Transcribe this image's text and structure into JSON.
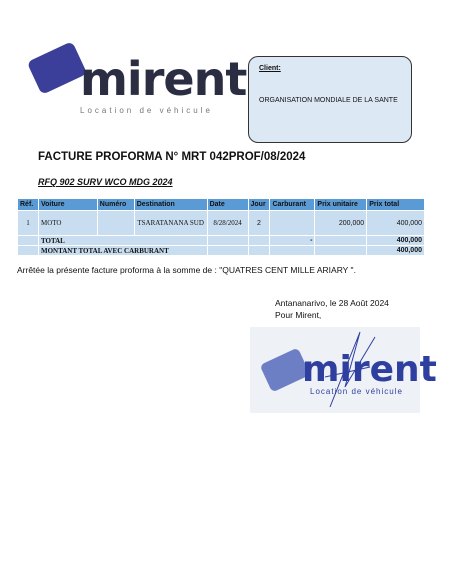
{
  "logo": {
    "word": "mirent",
    "subtitle": "Location de véhicule"
  },
  "client": {
    "label": "Client:",
    "name": "ORGANISATION MONDIALE DE LA SANTE"
  },
  "title": "FACTURE PROFORMA N° MRT 042PROF/08/2024",
  "reference": "RFQ 902 SURV WCO MDG 2024",
  "table": {
    "headers": [
      "Réf.",
      "Voiture",
      "Numéro",
      "Destination",
      "Date",
      "Jour",
      "Carburant",
      "Prix unitaire",
      "Prix total"
    ],
    "rows": [
      {
        "ref": "1",
        "voiture": "MOTO",
        "numero": "",
        "destination": "TSARATANANA SUD",
        "date": "8/28/2024",
        "jour": "2",
        "carburant": "",
        "prix_unitaire": "200,000",
        "prix_total": "400,000"
      }
    ],
    "total_label": "TOTAL",
    "total_carburant": "-",
    "total_value": "400,000",
    "montant_label": "MONTANT TOTAL AVEC CARBURANT",
    "montant_value": "400,000"
  },
  "arrete": "Arrêtée la présente facture proforma à la somme de :  \"QUATRES CENT MILLE ARIARY \".",
  "place_date": "Antananarivo, le 28 Août 2024",
  "signoff": "Pour Mirent,",
  "stamp": {
    "word": "mirent",
    "subtitle": "Location de véhicule"
  }
}
